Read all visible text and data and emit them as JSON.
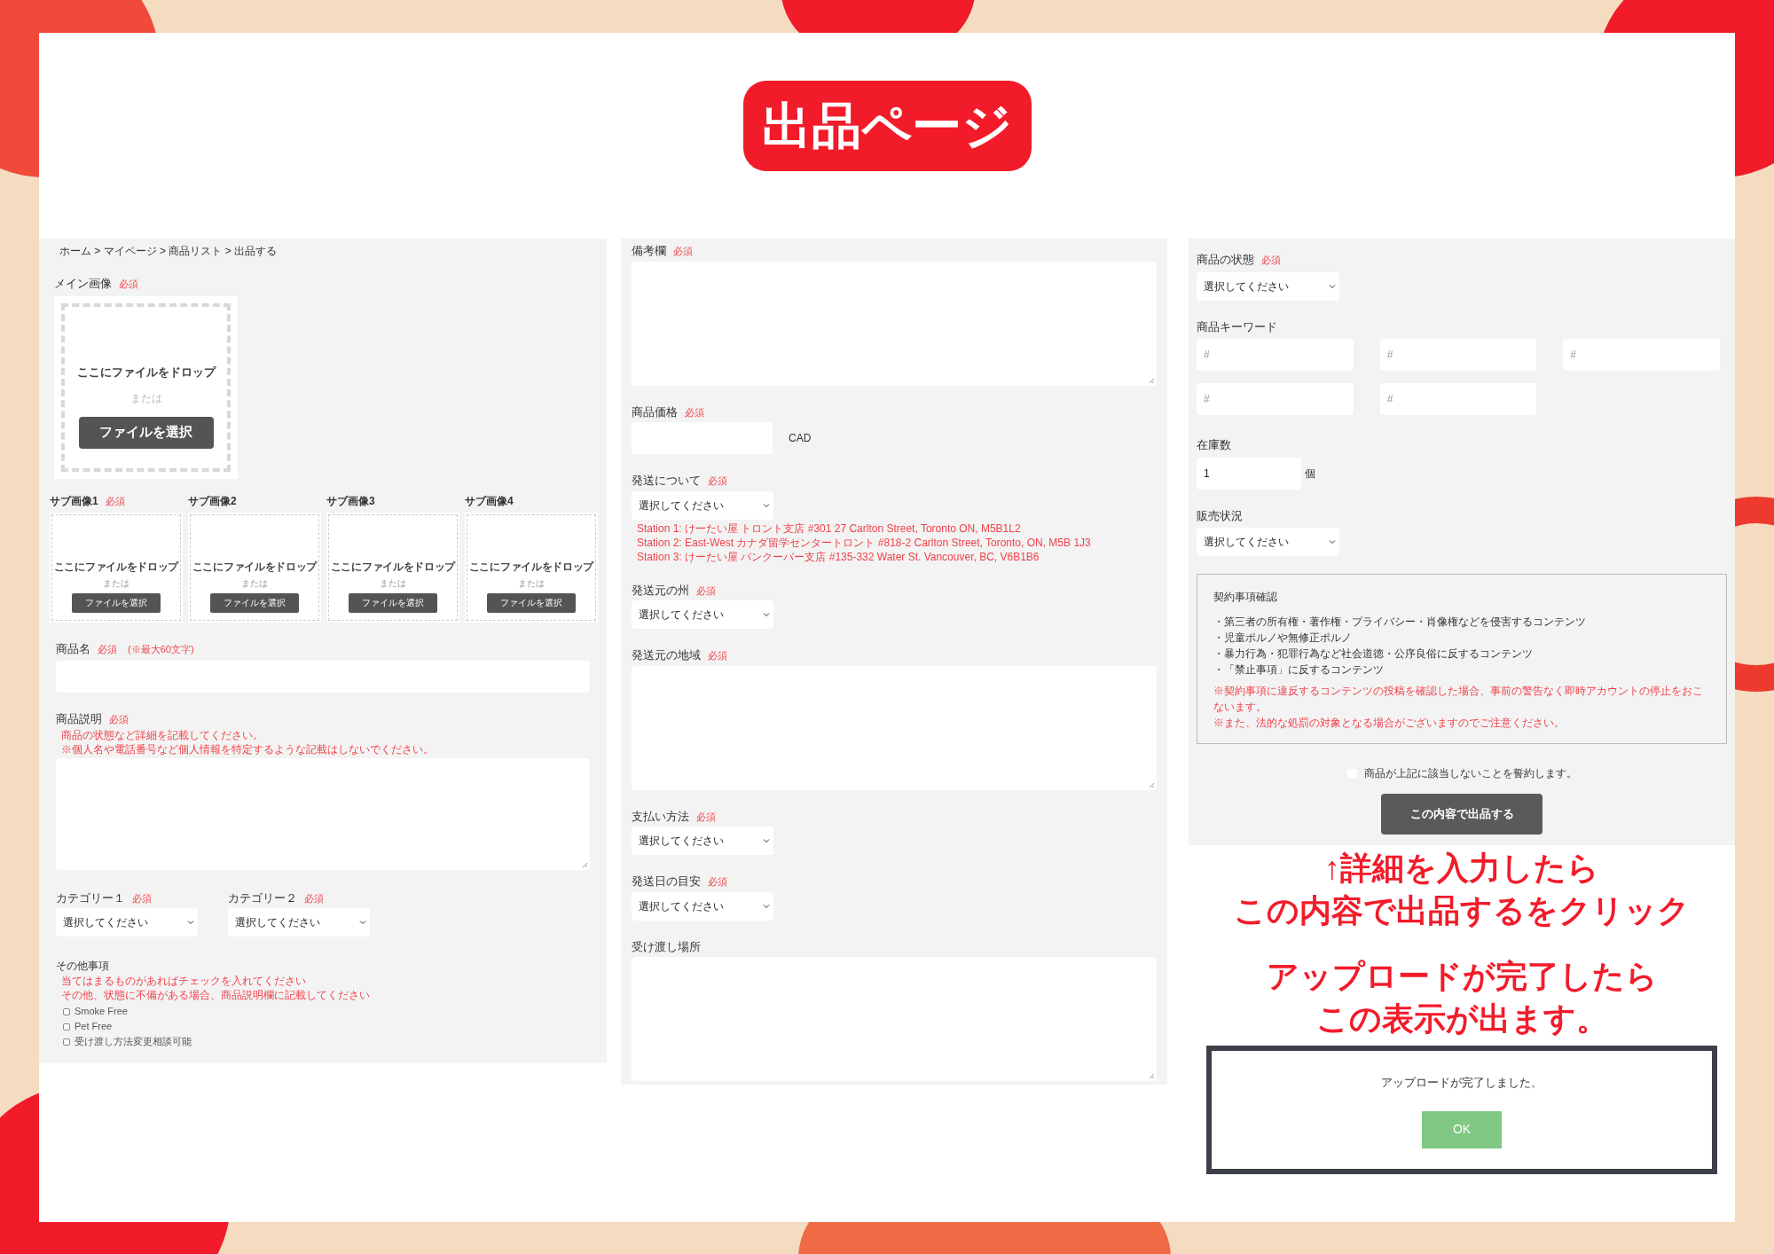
{
  "title": "出品ページ",
  "left": {
    "breadcrumb": "ホーム > マイページ > 商品リスト > 出品する",
    "main_image": {
      "label": "メイン画像",
      "required_mark": "必須",
      "drop_text": "ここにファイルをドロップ",
      "or_text": "または",
      "button": "ファイルを選択"
    },
    "sub_images": [
      {
        "label": "サブ画像1",
        "required_mark": "必須",
        "drop_text": "ここにファイルをドロップ",
        "or_text": "または",
        "button": "ファイルを選択"
      },
      {
        "label": "サブ画像2",
        "drop_text": "ここにファイルをドロップ",
        "or_text": "または",
        "button": "ファイルを選択"
      },
      {
        "label": "サブ画像3",
        "drop_text": "ここにファイルをドロップ",
        "or_text": "または",
        "button": "ファイルを選択"
      },
      {
        "label": "サブ画像4",
        "drop_text": "ここにファイルをドロップ",
        "or_text": "または",
        "button": "ファイルを選択"
      }
    ],
    "product_name": {
      "label": "商品名",
      "required_mark": "必須",
      "note": "(※最大60文字)"
    },
    "description": {
      "label": "商品説明",
      "required_mark": "必須",
      "notes": [
        "商品の状態など詳細を記載してください。",
        "※個人名や電話番号など個人情報を特定するような記載はしないでください。"
      ]
    },
    "categories": [
      {
        "label": "カテゴリー１",
        "required_mark": "必須",
        "value": "選択してください"
      },
      {
        "label": "カテゴリー２",
        "required_mark": "必須",
        "value": "選択してください"
      }
    ],
    "other": {
      "label": "その他事項",
      "notes": [
        "当てはまるものがあればチェックを入れてください",
        "その他、状態に不備がある場合、商品説明欄に記載してください"
      ],
      "options": [
        {
          "label": "Smoke Free",
          "checked": false
        },
        {
          "label": "Pet Free",
          "checked": false
        },
        {
          "label": "受け渡し方法変更相談可能",
          "checked": false
        }
      ]
    }
  },
  "middle": [
    {
      "kind": "textarea",
      "label": "備考欄",
      "required_mark": "必須"
    },
    {
      "kind": "price",
      "label": "商品価格",
      "required_mark": "必須",
      "unit": "CAD"
    },
    {
      "kind": "select",
      "label": "発送について",
      "required_mark": "必須",
      "value": "選択してください",
      "notes": [
        "Station 1: けーたい屋 トロント支店 #301 27 Carlton Street, Toronto ON, M5B1L2",
        "Station 2: East-West カナダ留学センタートロント #818-2 Carlton Street, Toronto, ON, M5B 1J3",
        "Station 3: けーたい屋 バンクーバー支店 #135-332 Water St. Vancouver, BC, V6B1B6"
      ]
    },
    {
      "kind": "select",
      "label": "発送元の州",
      "required_mark": "必須",
      "value": "選択してください"
    },
    {
      "kind": "textarea",
      "label": "発送元の地域",
      "required_mark": "必須"
    },
    {
      "kind": "select",
      "label": "支払い方法",
      "required_mark": "必須",
      "value": "選択してください"
    },
    {
      "kind": "select",
      "label": "発送日の目安",
      "required_mark": "必須",
      "value": "選択してください"
    },
    {
      "kind": "textarea",
      "label": "受け渡し場所"
    }
  ],
  "right": {
    "condition": {
      "label": "商品の状態",
      "required_mark": "必須",
      "value": "選択してください"
    },
    "keywords": {
      "label": "商品キーワード",
      "fields": [
        {
          "placeholder": "#"
        },
        {
          "placeholder": "#"
        },
        {
          "placeholder": "#"
        },
        {
          "placeholder": "#"
        },
        {
          "placeholder": "#"
        }
      ]
    },
    "stock": {
      "label": "在庫数",
      "value": "1",
      "unit": "個"
    },
    "sales_status": {
      "label": "販売状況",
      "value": "選択してください"
    },
    "terms": {
      "title": "契約事項確認",
      "items": [
        "・第三者の所有権・著作権・プライバシー・肖像権などを侵害するコンテンツ",
        "・児童ポルノや無修正ポルノ",
        "・暴力行為・犯罪行為など社会道徳・公序良俗に反するコンテンツ",
        "・「禁止事項」に反するコンテンツ"
      ],
      "warnings": [
        "※契約事項に違反するコンテンツの投稿を確認した場合、事前の警告なく即時アカウントの停止をおこないます。",
        "※また、法的な処罰の対象となる場合がございますのでご注意ください。"
      ]
    },
    "agree": {
      "label": "商品が上記に該当しないことを誓約します。",
      "checked": false
    },
    "submit": "この内容で出品する"
  },
  "annotations": [
    [
      "↑詳細を入力したら",
      "この内容で出品するをクリック"
    ],
    [
      "アップロードが完了したら",
      "この表示が出ます。"
    ]
  ],
  "dialog": {
    "message": "アップロードが完了しました。",
    "button": "OK"
  }
}
